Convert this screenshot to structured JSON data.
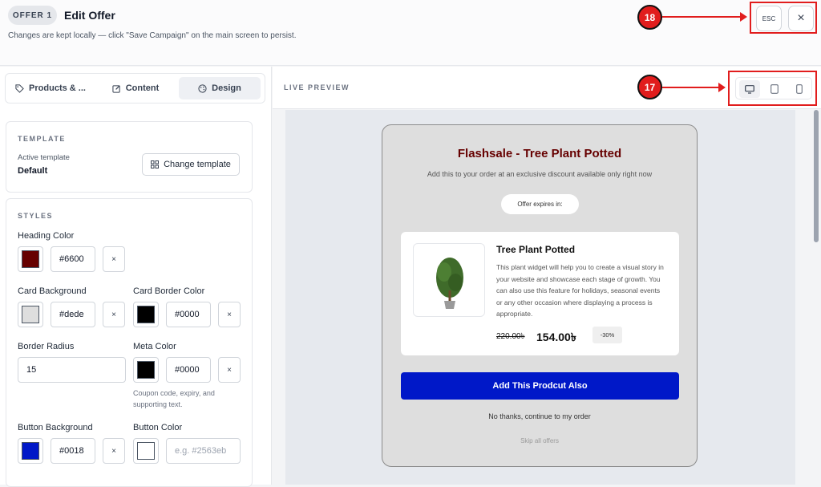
{
  "header": {
    "badge": "OFFER 1",
    "title": "Edit Offer",
    "subtitle": "Changes are kept locally — click \"Save Campaign\" on the main screen to persist.",
    "esc_label": "ESC",
    "close_icon": "×"
  },
  "annotations": {
    "marker_18": "18",
    "marker_17": "17"
  },
  "sidebar": {
    "tabs": [
      {
        "label": "Products & ...",
        "icon": "tag-icon"
      },
      {
        "label": "Content",
        "icon": "edit-icon"
      },
      {
        "label": "Design",
        "icon": "palette-icon",
        "active": true
      }
    ],
    "template": {
      "section_label": "TEMPLATE",
      "active_label": "Active template",
      "active_value": "Default",
      "change_button": "Change template"
    },
    "styles": {
      "section_label": "STYLES",
      "heading_color": {
        "label": "Heading Color",
        "value": "#6600",
        "color": "#660000"
      },
      "card_background": {
        "label": "Card Background",
        "value": "#dede",
        "color": "#dedede"
      },
      "card_border_color": {
        "label": "Card Border Color",
        "value": "#0000",
        "color": "#000000"
      },
      "border_radius": {
        "label": "Border Radius",
        "value": "15"
      },
      "meta_color": {
        "label": "Meta Color",
        "value": "#0000",
        "color": "#000000",
        "help": "Coupon code, expiry, and supporting text."
      },
      "button_background": {
        "label": "Button Background",
        "value": "#0018",
        "color": "#0018c8"
      },
      "button_color": {
        "label": "Button Color",
        "placeholder": "e.g. #2563eb",
        "color": "#ffffff"
      },
      "clear_label": "×"
    }
  },
  "preview": {
    "label": "LIVE PREVIEW",
    "devices": [
      "desktop-icon",
      "tablet-icon",
      "mobile-icon"
    ],
    "offer": {
      "heading": "Flashsale - Tree Plant Potted",
      "subheading": "Add this to your order at an exclusive discount available only right now",
      "expires_label": "Offer expires in:",
      "product": {
        "name": "Tree Plant Potted",
        "description": "This plant widget will help you to create a visual story in your website and showcase each stage of growth. You can also use this feature for holidays, seasonal events or any other occasion where displaying a process is appropriate.",
        "old_price": "220.00৳",
        "new_price": "154.00৳",
        "discount": "-30%"
      },
      "add_button": "Add This Prodcut Also",
      "decline": "No thanks, continue to my order",
      "skip": "Skip all offers"
    }
  }
}
